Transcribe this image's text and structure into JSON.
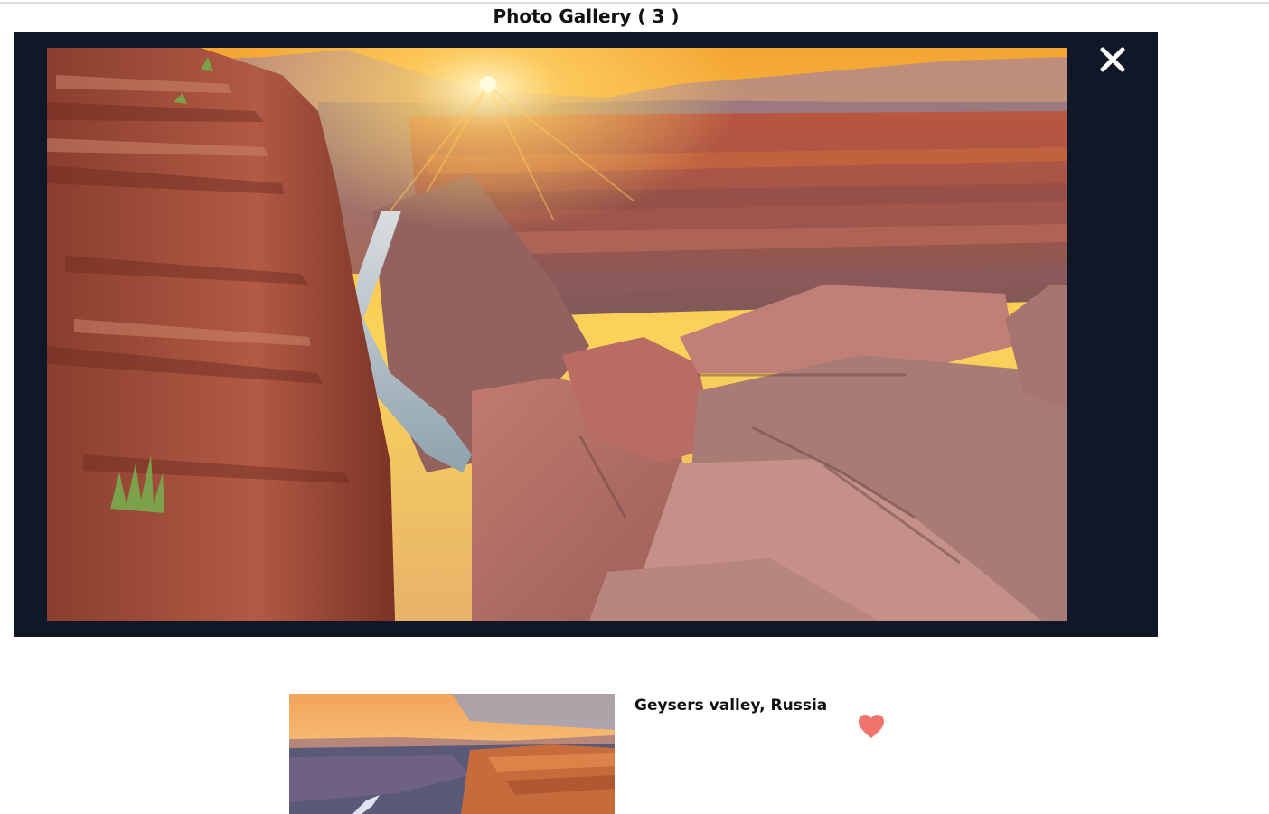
{
  "gallery": {
    "title": "Photo Gallery ( 3 )"
  },
  "viewer": {
    "close_icon": "close-icon",
    "photo_alt": "Canyon cliff overlook at sunset with river below"
  },
  "cards": [
    {
      "title": "Geysers valley, Russia",
      "favorite_icon": "heart-icon",
      "favorite_color": "#f0746e"
    }
  ],
  "colors": {
    "viewer_bg": "#101827",
    "close_icon": "#ffffff",
    "heart": "#f0746e"
  }
}
